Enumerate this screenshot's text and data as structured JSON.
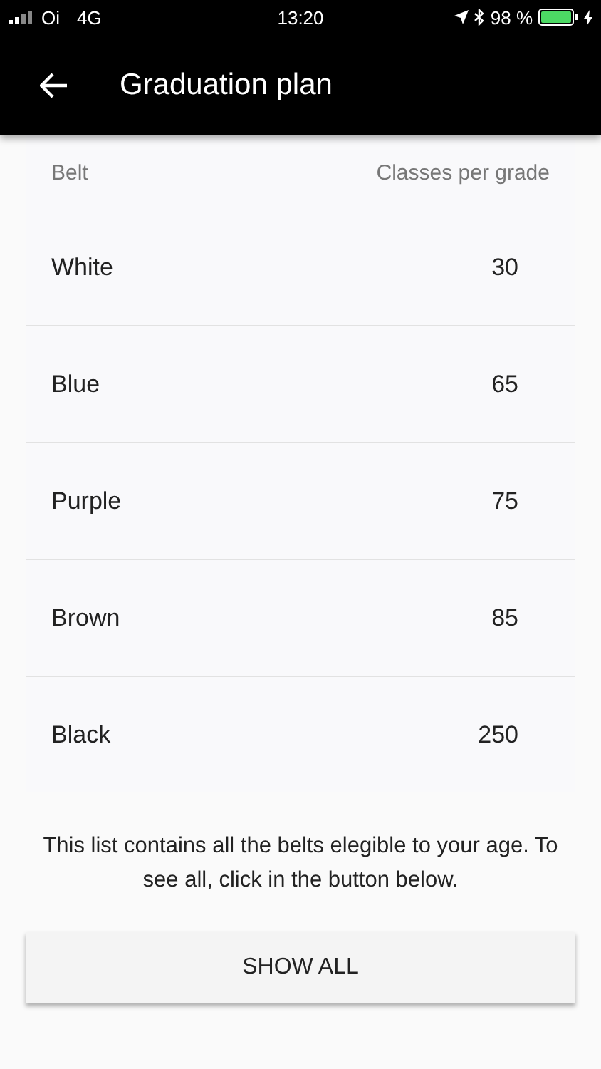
{
  "status_bar": {
    "carrier": "Oi",
    "network": "4G",
    "time": "13:20",
    "battery": "98 %"
  },
  "app_bar": {
    "title": "Graduation plan"
  },
  "table": {
    "columns": [
      "Belt",
      "Classes per grade"
    ],
    "rows": [
      {
        "belt": "White",
        "classes": "30"
      },
      {
        "belt": "Blue",
        "classes": "65"
      },
      {
        "belt": "Purple",
        "classes": "75"
      },
      {
        "belt": "Brown",
        "classes": "85"
      },
      {
        "belt": "Black",
        "classes": "250"
      }
    ]
  },
  "note": "This list contains all the belts elegible to your age. To see all, click in the button below.",
  "button": "SHOW ALL"
}
